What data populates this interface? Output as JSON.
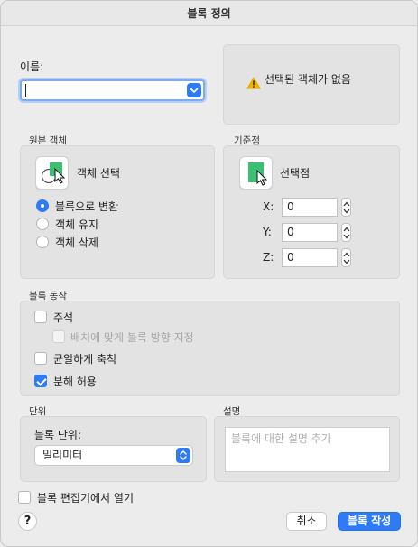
{
  "window": {
    "title": "블록 정의"
  },
  "name": {
    "label": "이름:",
    "value": ""
  },
  "warning": {
    "text": "선택된 객체가 없음"
  },
  "source_objects": {
    "section_label": "원본 객체",
    "select_button_label": "객체 선택",
    "options": [
      {
        "label": "블록으로 변환",
        "selected": true
      },
      {
        "label": "객체 유지",
        "selected": false
      },
      {
        "label": "객체 삭제",
        "selected": false
      }
    ]
  },
  "base_point": {
    "section_label": "기준점",
    "pick_button_label": "선택점",
    "x_label": "X:",
    "x_value": "0",
    "y_label": "Y:",
    "y_value": "0",
    "z_label": "Z:",
    "z_value": "0"
  },
  "behavior": {
    "section_label": "블록 동작",
    "annotative": {
      "label": "주석",
      "checked": false
    },
    "match_orientation": {
      "label": "배치에 맞게 블록 방향 지정",
      "checked": false,
      "enabled": false
    },
    "scale_uniformly": {
      "label": "균일하게 축척",
      "checked": false
    },
    "allow_exploding": {
      "label": "분해 허용",
      "checked": true
    }
  },
  "units": {
    "section_label": "단위",
    "block_unit_label": "블록 단위:",
    "block_unit_value": "밀리미터"
  },
  "description": {
    "section_label": "설명",
    "placeholder": "블록에 대한 설명 추가"
  },
  "open_in_editor": {
    "label": "블록 편집기에서 열기",
    "checked": false
  },
  "buttons": {
    "help": "?",
    "cancel": "취소",
    "ok": "블록 작성"
  },
  "colors": {
    "accent": "#2f7bf5",
    "warning": "#f0b400",
    "block_icon": "#3dbf73"
  }
}
